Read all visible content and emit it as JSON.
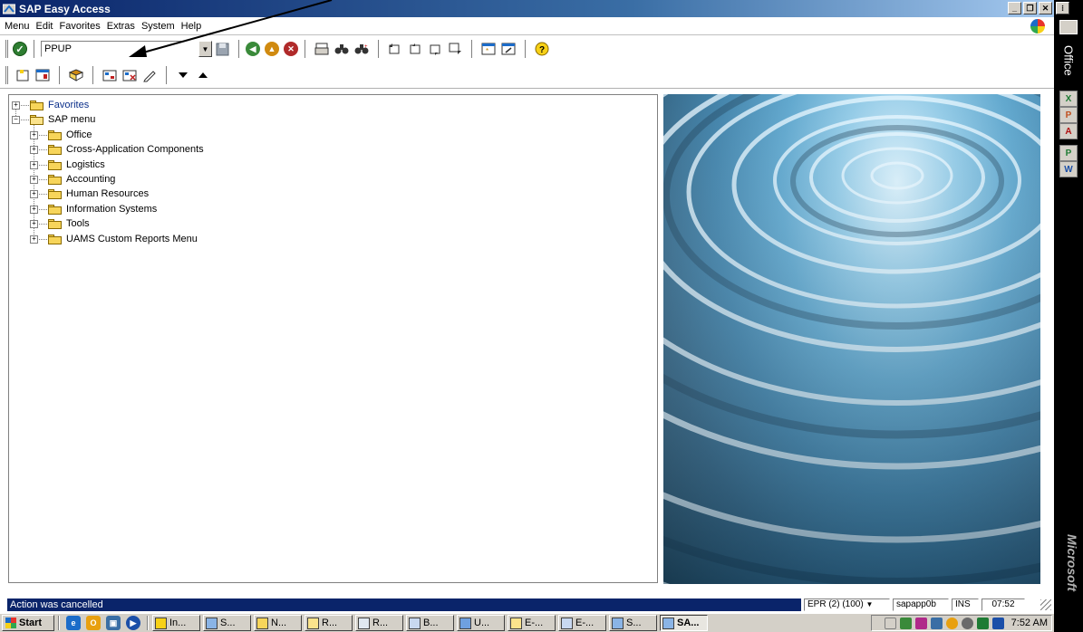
{
  "window": {
    "title": "SAP Easy Access"
  },
  "menubar": {
    "items": [
      "Menu",
      "Edit",
      "Favorites",
      "Extras",
      "System",
      "Help"
    ]
  },
  "command_field": {
    "value": "PPUP"
  },
  "tree": {
    "root_favorites": "Favorites",
    "root_sap_menu": "SAP menu",
    "items": [
      {
        "label": "Office"
      },
      {
        "label": "Cross-Application Components"
      },
      {
        "label": "Logistics"
      },
      {
        "label": "Accounting"
      },
      {
        "label": "Human Resources"
      },
      {
        "label": "Information Systems"
      },
      {
        "label": "Tools"
      },
      {
        "label": "UAMS Custom Reports Menu"
      }
    ]
  },
  "officebar": {
    "label": "Office",
    "vendor": "Microsoft"
  },
  "statusbar": {
    "message": "Action was cancelled",
    "system": "EPR (2) (100)",
    "server": "sapapp0b",
    "mode": "INS",
    "time": "07:52"
  },
  "taskbar": {
    "start": "Start",
    "tasks": [
      "In...",
      "S...",
      "N...",
      "R...",
      "R...",
      "B...",
      "U...",
      "E-...",
      "E-...",
      "S...",
      "SA..."
    ],
    "clock": "7:52 AM"
  },
  "colors": {
    "title_bar": "#0a246a",
    "status_message_bg": "#0a246a",
    "folder": "#f7d55a"
  }
}
